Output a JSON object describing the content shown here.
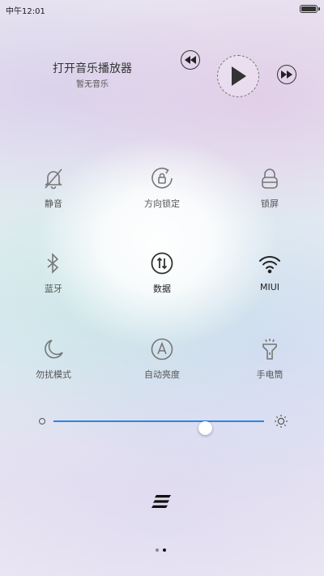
{
  "status": {
    "time": "中午12:01",
    "battery_level": 1.0
  },
  "player": {
    "title": "打开音乐播放器",
    "subtitle": "暂无音乐",
    "prev_icon": "rewind-icon",
    "play_icon": "play-icon",
    "next_icon": "fast-forward-icon"
  },
  "toggles": [
    {
      "label": "静音",
      "icon": "bell-muted-icon"
    },
    {
      "label": "方向锁定",
      "icon": "rotation-lock-icon"
    },
    {
      "label": "锁屏",
      "icon": "lock-icon"
    },
    {
      "label": "蓝牙",
      "icon": "bluetooth-icon"
    },
    {
      "label": "数据",
      "icon": "mobile-data-icon"
    },
    {
      "label": "MIUI",
      "icon": "wifi-icon"
    },
    {
      "label": "勿扰模式",
      "icon": "moon-icon"
    },
    {
      "label": "自动亮度",
      "icon": "auto-brightness-icon"
    },
    {
      "label": "手电筒",
      "icon": "flashlight-icon"
    }
  ],
  "brightness": {
    "level": 0.72,
    "accent": "#2c84ea"
  },
  "pager": {
    "pages": 2,
    "current": 2
  }
}
